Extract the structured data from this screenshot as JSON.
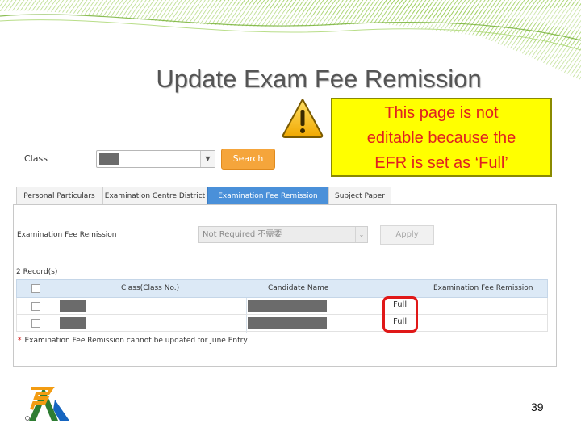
{
  "slide": {
    "title": "Update Exam Fee Remission",
    "callout_lines": [
      "This page is not",
      "editable because the",
      "EFR is set as ‘Full’"
    ],
    "page_number": "39"
  },
  "form": {
    "class_label": "Class",
    "search_label": "Search"
  },
  "tabs": [
    {
      "label": "Personal Particulars",
      "active": false
    },
    {
      "label": "Examination Centre District",
      "active": false
    },
    {
      "label": "Examination Fee Remission",
      "active": true
    },
    {
      "label": "Subject Paper",
      "active": false
    }
  ],
  "efr": {
    "label": "Examination Fee Remission",
    "selected": "Not Required 不需要",
    "apply_label": "Apply"
  },
  "records_text": "2  Record(s)",
  "table": {
    "columns": [
      "Class(Class No.)",
      "Candidate Name",
      "Examination Fee Remission"
    ],
    "rows": [
      {
        "remission": "Full"
      },
      {
        "remission": "Full"
      }
    ]
  },
  "note": {
    "star": "*",
    "text": "Examination Fee Remission cannot be updated for June Entry"
  },
  "colors": {
    "accent_tab": "#4a90d9",
    "search_button": "#f5a53b",
    "callout_bg": "#ffff00",
    "callout_text": "#e02020",
    "highlight": "#e01818"
  }
}
